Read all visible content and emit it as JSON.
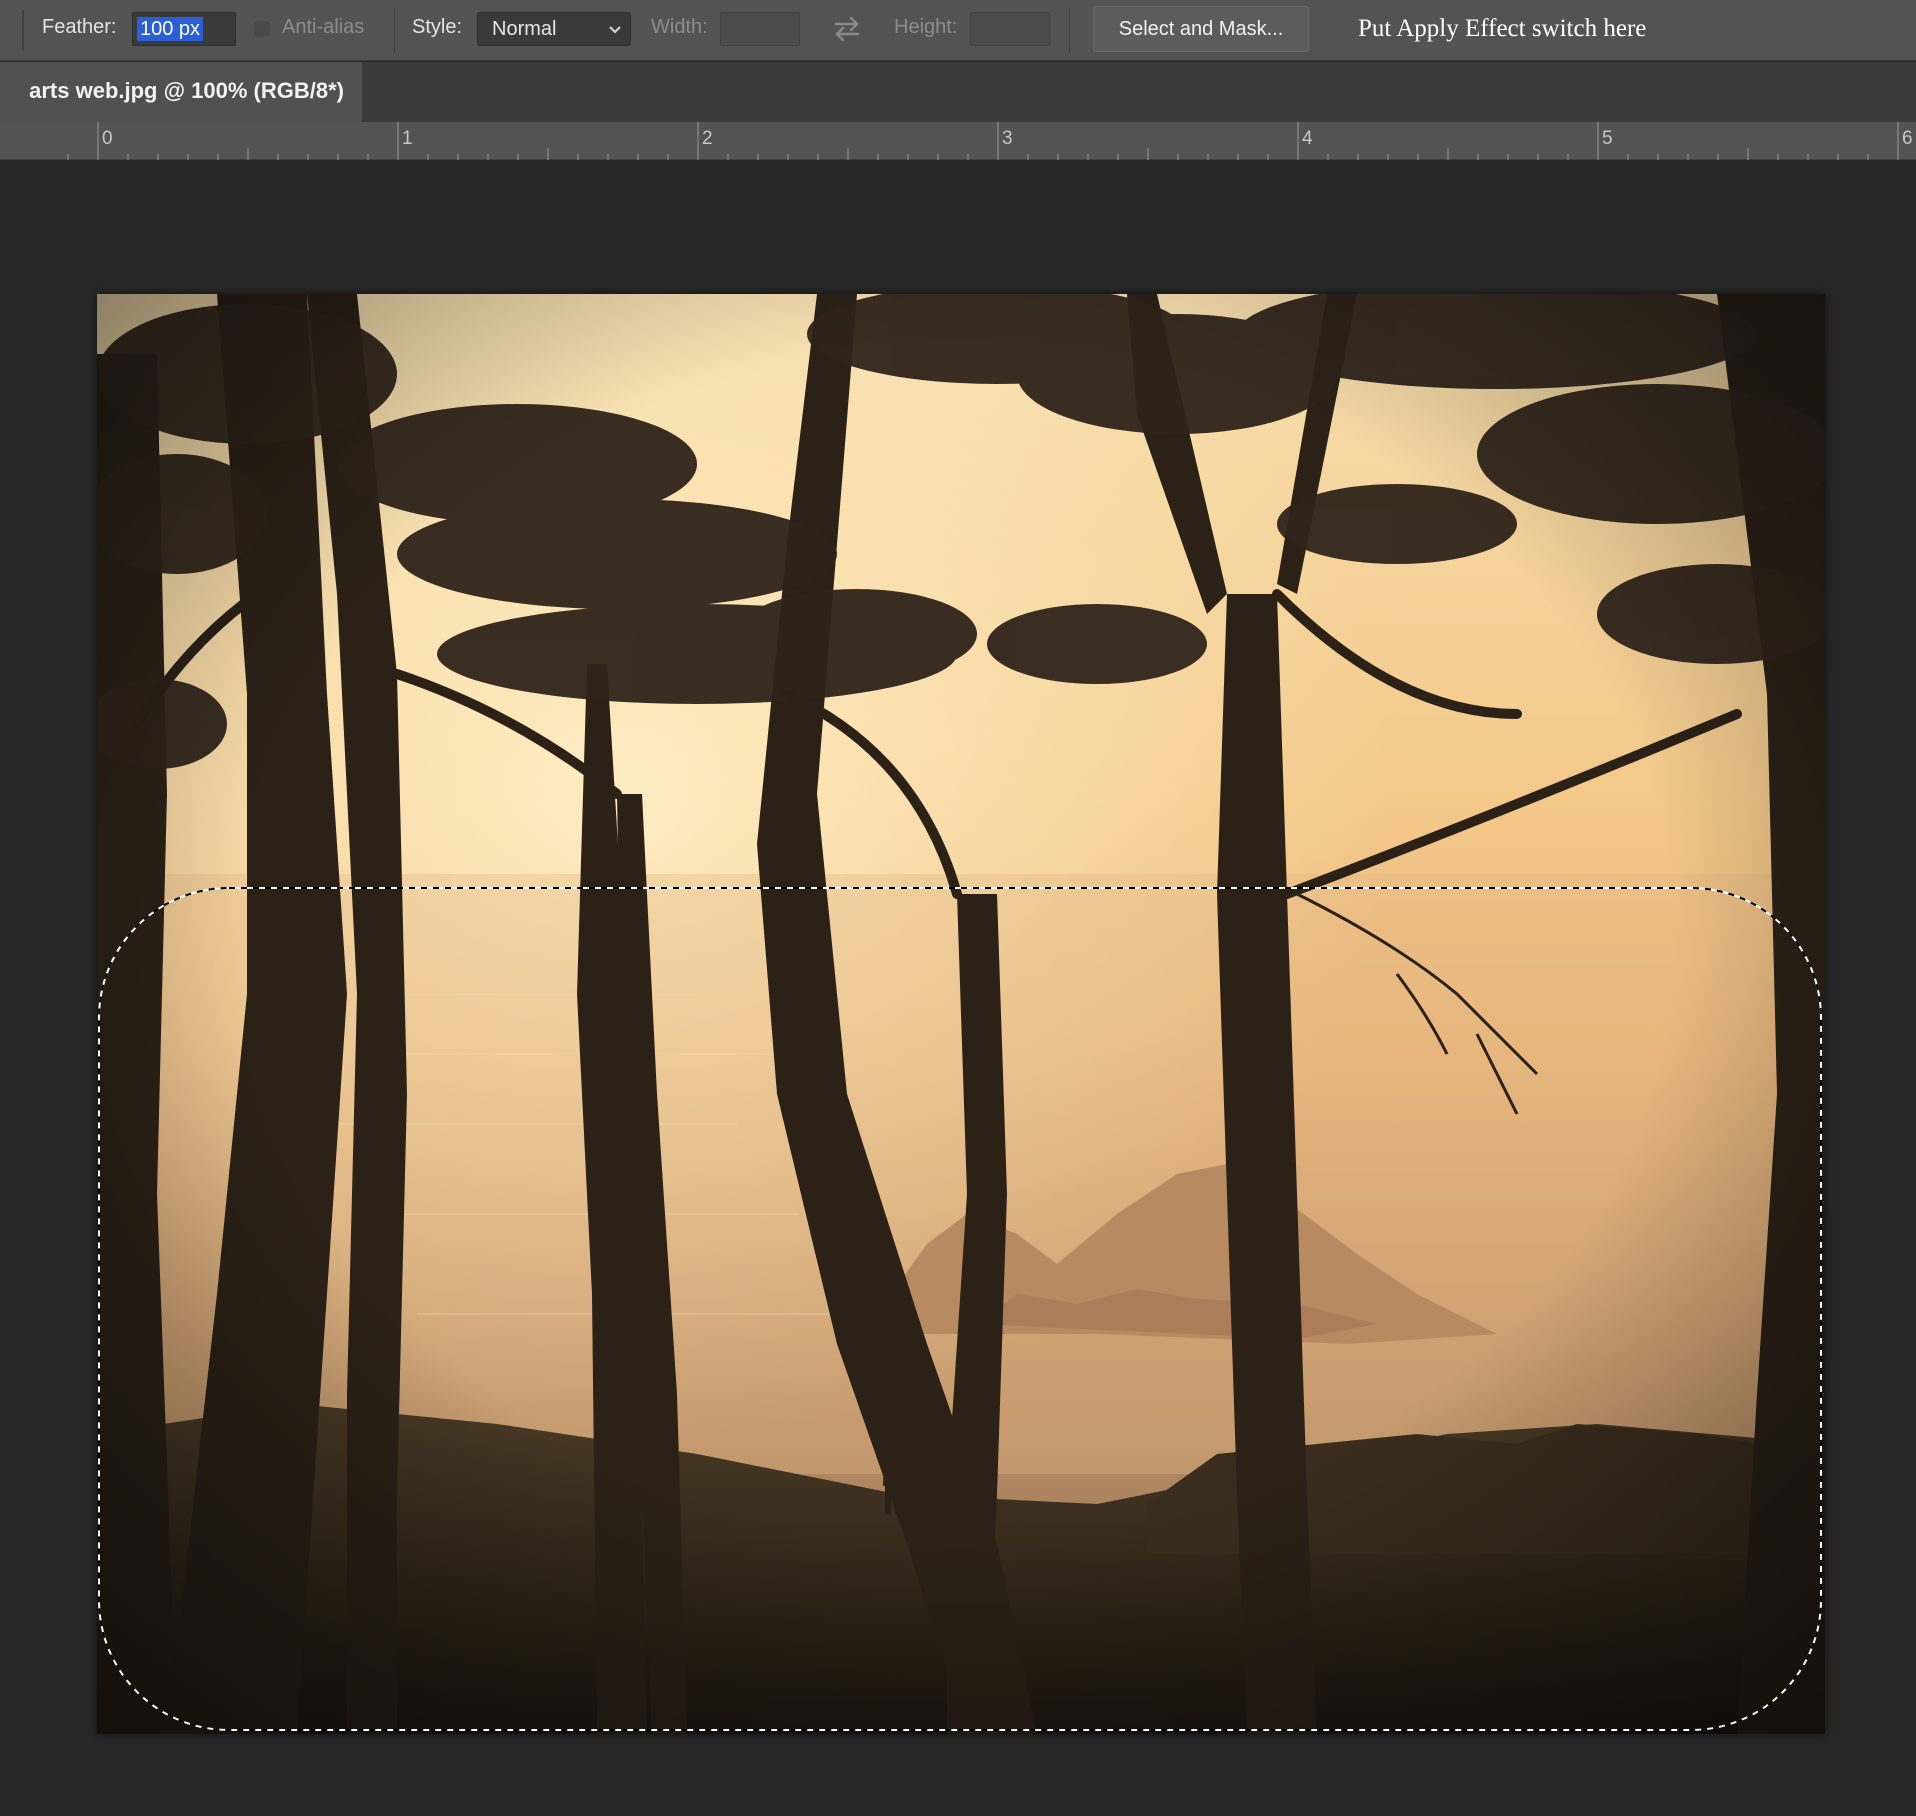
{
  "options_bar": {
    "feather_label": "Feather:",
    "feather_value": "100 px",
    "antialias_label": "Anti-alias",
    "style_label": "Style:",
    "style_value": "Normal",
    "width_label": "Width:",
    "width_value": "",
    "height_label": "Height:",
    "height_value": "",
    "select_and_mask_label": "Select and Mask...",
    "apply_effect_note": "Put Apply Effect switch here"
  },
  "document_tab": {
    "title": "arts web.jpg @ 100% (RGB/8*)"
  },
  "ruler": {
    "units": [
      "0",
      "1",
      "2",
      "3",
      "4",
      "5",
      "6"
    ]
  },
  "icons": {
    "dropdown": "chevron-down-icon",
    "swap": "swap-arrows-icon"
  },
  "colors": {
    "selection_highlight": "#2b5fd6",
    "sky_glow": "#f6d7a0",
    "silhouette": "#2a2016"
  }
}
